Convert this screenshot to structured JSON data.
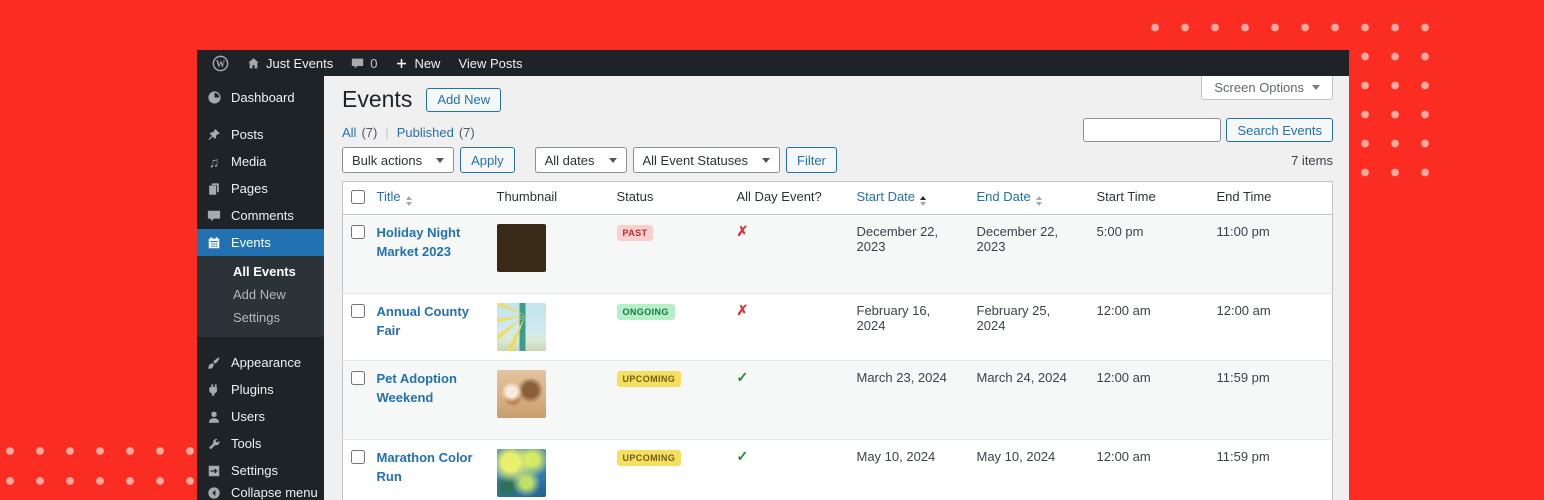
{
  "colors": {
    "desktop_background": "#fb2d22",
    "dot": "#fca9a2",
    "accent_blue": "#2271b1",
    "status_past": "#b32d2e",
    "status_ongoing": "#19793e",
    "status_upcoming": "#6d5f1b"
  },
  "admin_bar": {
    "site_name": "Just Events",
    "comment_count": "0",
    "new_label": "New",
    "view_posts_label": "View Posts"
  },
  "sidebar": {
    "items": [
      {
        "label": "Dashboard",
        "icon": "dashboard-icon"
      },
      {
        "label": "Posts",
        "icon": "pin-icon"
      },
      {
        "label": "Media",
        "icon": "media-icon",
        "glyph": "♫"
      },
      {
        "label": "Pages",
        "icon": "pages-icon"
      },
      {
        "label": "Comments",
        "icon": "comments-icon"
      },
      {
        "label": "Events",
        "icon": "calendar-icon",
        "active": true
      }
    ],
    "events_submenu": [
      {
        "label": "All Events",
        "current": true
      },
      {
        "label": "Add New"
      },
      {
        "label": "Settings"
      }
    ],
    "items2": [
      {
        "label": "Appearance",
        "icon": "brush-icon"
      },
      {
        "label": "Plugins",
        "icon": "plug-icon"
      },
      {
        "label": "Users",
        "icon": "user-icon"
      },
      {
        "label": "Tools",
        "icon": "wrench-icon"
      },
      {
        "label": "Settings",
        "icon": "sliders-icon"
      }
    ],
    "collapse_label": "Collapse menu"
  },
  "header": {
    "page_title": "Events",
    "add_new_label": "Add New",
    "screen_options_label": "Screen Options"
  },
  "views": {
    "all_label": "All",
    "all_count": "(7)",
    "separator": "|",
    "published_label": "Published",
    "published_count": "(7)"
  },
  "toolbar": {
    "bulk_actions": "Bulk actions",
    "apply_label": "Apply",
    "all_dates": "All dates",
    "all_statuses": "All Event Statuses",
    "filter_label": "Filter",
    "items_count": "7 items",
    "search_button_label": "Search Events"
  },
  "table": {
    "columns": [
      "Title",
      "Thumbnail",
      "Status",
      "All Day Event?",
      "Start Date",
      "End Date",
      "Start Time",
      "End Time"
    ],
    "rows": [
      {
        "title": "Holiday Night Market 2023",
        "thumbnail": "night-market-photo",
        "status": "PAST",
        "all_day_mark": "✗",
        "start_date": "December 22, 2023",
        "end_date": "December 22, 2023",
        "start_time": "5:00 pm",
        "end_time": "11:00 pm"
      },
      {
        "title": "Annual County Fair",
        "thumbnail": "county-fair-photo",
        "status": "ONGOING",
        "all_day_mark": "✗",
        "start_date": "February 16, 2024",
        "end_date": "February 25, 2024",
        "start_time": "12:00 am",
        "end_time": "12:00 am"
      },
      {
        "title": "Pet Adoption Weekend",
        "thumbnail": "running-dogs-photo",
        "status": "UPCOMING",
        "all_day_mark": "✓",
        "start_date": "March 23, 2024",
        "end_date": "March 24, 2024",
        "start_time": "12:00 am",
        "end_time": "11:59 pm"
      },
      {
        "title": "Marathon Color Run",
        "thumbnail": "color-paint-photo",
        "status": "UPCOMING",
        "all_day_mark": "✓",
        "start_date": "May 10, 2024",
        "end_date": "May 10, 2024",
        "start_time": "12:00 am",
        "end_time": "11:59 pm"
      }
    ]
  }
}
